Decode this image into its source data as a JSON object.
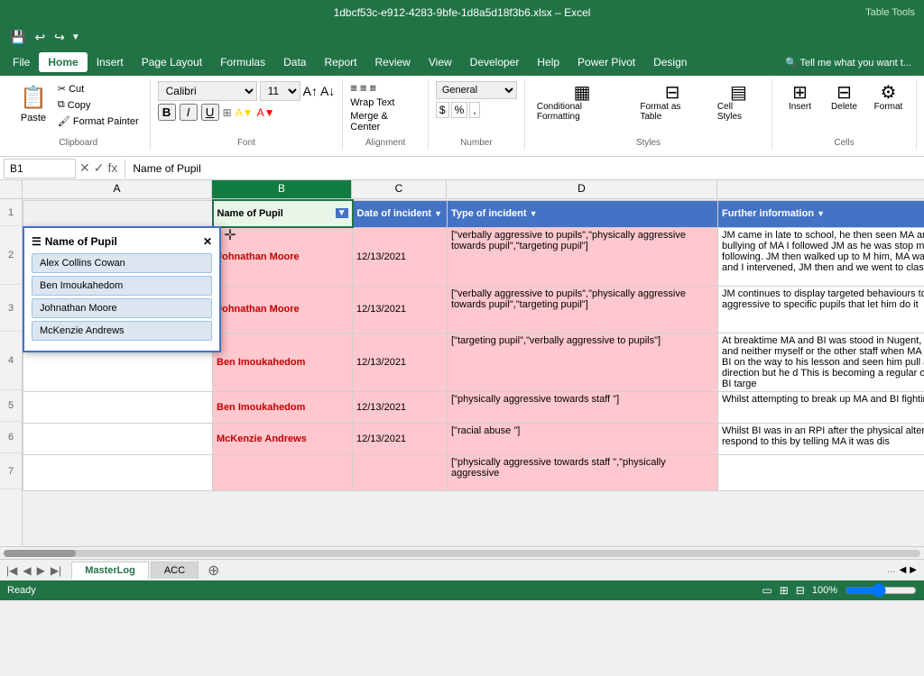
{
  "titleBar": {
    "filename": "1dbcf53c-e912-4283-9bfe-1d8a5d18f3b6.xlsx",
    "app": "Excel",
    "tableTools": "Table Tools"
  },
  "menuBar": {
    "items": [
      "File",
      "Home",
      "Insert",
      "Page Layout",
      "Formulas",
      "Data",
      "Report",
      "Review",
      "View",
      "Developer",
      "Help",
      "Power Pivot"
    ],
    "activeTab": "Home",
    "designTab": "Design",
    "tellMe": "Tell me what you want t..."
  },
  "ribbon": {
    "clipboard": {
      "label": "Clipboard",
      "paste": "Paste",
      "cut": "Cut",
      "copy": "Copy",
      "formatPainter": "Format Painter"
    },
    "font": {
      "label": "Font",
      "fontName": "Calibri",
      "fontSize": "11",
      "bold": "B",
      "italic": "I",
      "underline": "U"
    },
    "alignment": {
      "label": "Alignment",
      "wrapText": "Wrap Text",
      "mergeCenter": "Merge & Center"
    },
    "number": {
      "label": "Number",
      "format": "General"
    },
    "styles": {
      "label": "Styles",
      "conditionalFormatting": "Conditional Formatting",
      "formatAsTable": "Format as Table",
      "cellStyles": "Cell Styles",
      "format": "Format"
    },
    "cells": {
      "label": "Cells",
      "insert": "Insert",
      "delete": "Delete"
    }
  },
  "quickAccess": {
    "buttons": [
      "save",
      "undo",
      "redo",
      "more"
    ]
  },
  "formulaBar": {
    "cellRef": "B1",
    "formula": "Name of Pupil"
  },
  "columns": {
    "headers": [
      "",
      "A",
      "B",
      "C",
      "D"
    ]
  },
  "tableHeaders": {
    "nameOfPupil": "Name of Pupil",
    "dateOfIncident": "Date of incident",
    "typeOfIncident": "Type of incident",
    "furtherInformation": "Further information"
  },
  "filterPanel": {
    "title": "Name of Pupil",
    "items": [
      "Alex Collins Cowan",
      "Ben Imoukahedom",
      "Johnathan Moore",
      "McKenzie Andrews"
    ]
  },
  "tableData": [
    {
      "row": 1,
      "name": "",
      "date": "",
      "type": "",
      "info": ""
    },
    {
      "row": 2,
      "name": "Johnathan Moore",
      "date": "12/13/2021",
      "type": "[\"verbally aggressive to pupils\",\"physically aggressive towards pupil\",\"targeting pupil\"]",
      "info": "JM came in late to school, he then seen MA and s targetted bullying of MA I followed JM as he was stop me from following. JM then walked up to M him, MA walked away and I intervened, JM then and we went to class."
    },
    {
      "row": 3,
      "name": "Johnathan Moore",
      "date": "12/13/2021",
      "type": "[\"verbally aggressive to pupils\",\"physically aggressive towards pupil\",\"targeting pupil\"]",
      "info": "JM continues to display targeted behaviours tow aggressive to specific pupils that let him do it"
    },
    {
      "row": 4,
      "name": "Ben Imoukahedom",
      "date": "12/13/2021",
      "type": "[\"targeting pupil\",\"verbally aggressive to pupils\"]",
      "info": "At breaktime MA and BI was stood in Nugent, BI at the time and neither myself or the other staff when MA walked past BI on the way to his lesson and seen him pull a face in BI's direction but he d This is becoming a regular occurrence of BI targe"
    },
    {
      "row": 5,
      "name": "Ben Imoukahedom",
      "date": "12/13/2021",
      "type": "[\"physically aggressive towards staff \"]",
      "info": "Whilst attempting to break up MA and BI fighting"
    },
    {
      "row": 6,
      "name": "McKenzie Andrews",
      "date": "12/13/2021",
      "type": "[\"racial abuse \"]",
      "info": "Whilst BI was in an RPI after the physical altercati quickly to respond to this by telling MA it was dis"
    },
    {
      "row": 7,
      "name": "",
      "date": "",
      "type": "[\"physically aggressive towards staff \",\"physically aggressive",
      "info": ""
    }
  ],
  "sheets": {
    "tabs": [
      "MasterLog",
      "ACC"
    ],
    "active": "MasterLog"
  },
  "statusBar": {
    "ready": "Ready"
  }
}
